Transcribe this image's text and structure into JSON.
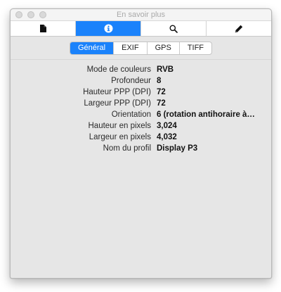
{
  "window": {
    "title": "En savoir plus"
  },
  "toolbar": {
    "buttons": [
      {
        "icon": "document-icon"
      },
      {
        "icon": "info-icon",
        "active": true
      },
      {
        "icon": "search-icon"
      },
      {
        "icon": "pencil-icon"
      }
    ]
  },
  "tabs": [
    {
      "label": "Général",
      "selected": true
    },
    {
      "label": "EXIF"
    },
    {
      "label": "GPS"
    },
    {
      "label": "TIFF"
    }
  ],
  "properties": [
    {
      "label": "Mode de couleurs",
      "value": "RVB"
    },
    {
      "label": "Profondeur",
      "value": "8"
    },
    {
      "label": "Hauteur PPP (DPI)",
      "value": "72"
    },
    {
      "label": "Largeur PPP (DPI)",
      "value": "72"
    },
    {
      "label": "Orientation",
      "value": "6 (rotation antihoraire à…"
    },
    {
      "label": "Hauteur en pixels",
      "value": "3,024"
    },
    {
      "label": "Largeur en pixels",
      "value": "4,032"
    },
    {
      "label": "Nom du profil",
      "value": "Display P3"
    }
  ],
  "colors": {
    "accent": "#1a82fb",
    "background": "#e6e6e6"
  }
}
